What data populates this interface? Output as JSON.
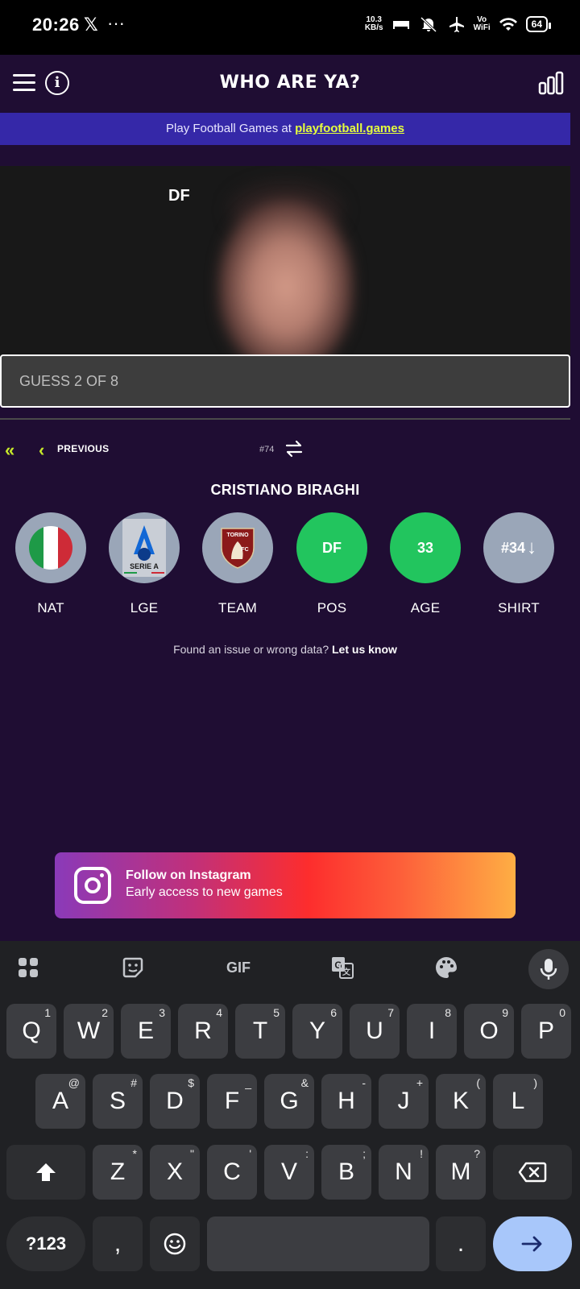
{
  "status_bar": {
    "time": "20:26",
    "x_app": "𝕏",
    "more": "···",
    "net_speed_value": "10.3",
    "net_speed_unit": "KB/s",
    "vowifi_top": "Vo",
    "vowifi_bottom": "WiFi",
    "battery": "64"
  },
  "header": {
    "title": "WHO ARE YA?",
    "menu_icon": "hamburger-icon",
    "info_icon": "info-icon",
    "stats_icon": "bar-chart-icon"
  },
  "banner": {
    "text": "Play Football Games at ",
    "link": "playfootball.games"
  },
  "photo": {
    "position_tag": "DF"
  },
  "guess": {
    "placeholder": "GUESS 2 OF 8"
  },
  "nav": {
    "previous_label": "PREVIOUS",
    "puzzle_number": "#74"
  },
  "player": {
    "name": "CRISTIANO BIRAGHI",
    "attributes": [
      {
        "label": "NAT",
        "value": "",
        "icon": "italy-flag-icon",
        "status": "neutral"
      },
      {
        "label": "LGE",
        "value": "SERIE A",
        "icon": "serie-a-logo-icon",
        "status": "neutral"
      },
      {
        "label": "TEAM",
        "value": "TORINO",
        "badge_letters": "FC",
        "icon": "torino-crest-icon",
        "status": "neutral"
      },
      {
        "label": "POS",
        "value": "DF",
        "status": "correct"
      },
      {
        "label": "AGE",
        "value": "33",
        "status": "correct"
      },
      {
        "label": "SHIRT",
        "value": "#34",
        "hint": "↓",
        "status": "neutral"
      }
    ]
  },
  "issue": {
    "text": "Found an issue or wrong data? ",
    "link": "Let us know"
  },
  "instagram": {
    "title": "Follow on Instagram",
    "subtitle": "Early access to new games"
  },
  "keyboard": {
    "toolbar": [
      "apps-grid-icon",
      "sticker-icon",
      "GIF",
      "translate-icon",
      "palette-icon",
      "mic-icon"
    ],
    "gif_label": "GIF",
    "row1": [
      [
        "Q",
        "1"
      ],
      [
        "W",
        "2"
      ],
      [
        "E",
        "3"
      ],
      [
        "R",
        "4"
      ],
      [
        "T",
        "5"
      ],
      [
        "Y",
        "6"
      ],
      [
        "U",
        "7"
      ],
      [
        "I",
        "8"
      ],
      [
        "O",
        "9"
      ],
      [
        "P",
        "0"
      ]
    ],
    "row2": [
      [
        "A",
        "@"
      ],
      [
        "S",
        "#"
      ],
      [
        "D",
        "$"
      ],
      [
        "F",
        "_"
      ],
      [
        "G",
        "&"
      ],
      [
        "H",
        "-"
      ],
      [
        "J",
        "+"
      ],
      [
        "K",
        "("
      ],
      [
        "L",
        ")"
      ]
    ],
    "row3": [
      [
        "Z",
        "*"
      ],
      [
        "X",
        "\""
      ],
      [
        "C",
        "'"
      ],
      [
        "V",
        ":"
      ],
      [
        "B",
        ";"
      ],
      [
        "N",
        "!"
      ],
      [
        "M",
        "?"
      ]
    ],
    "sym_label": "?123",
    "comma": ",",
    "period": ".",
    "emoji_icon": "emoji-icon",
    "shift_icon": "shift-icon",
    "backspace_icon": "backspace-icon",
    "enter_icon": "arrow-right-icon"
  }
}
